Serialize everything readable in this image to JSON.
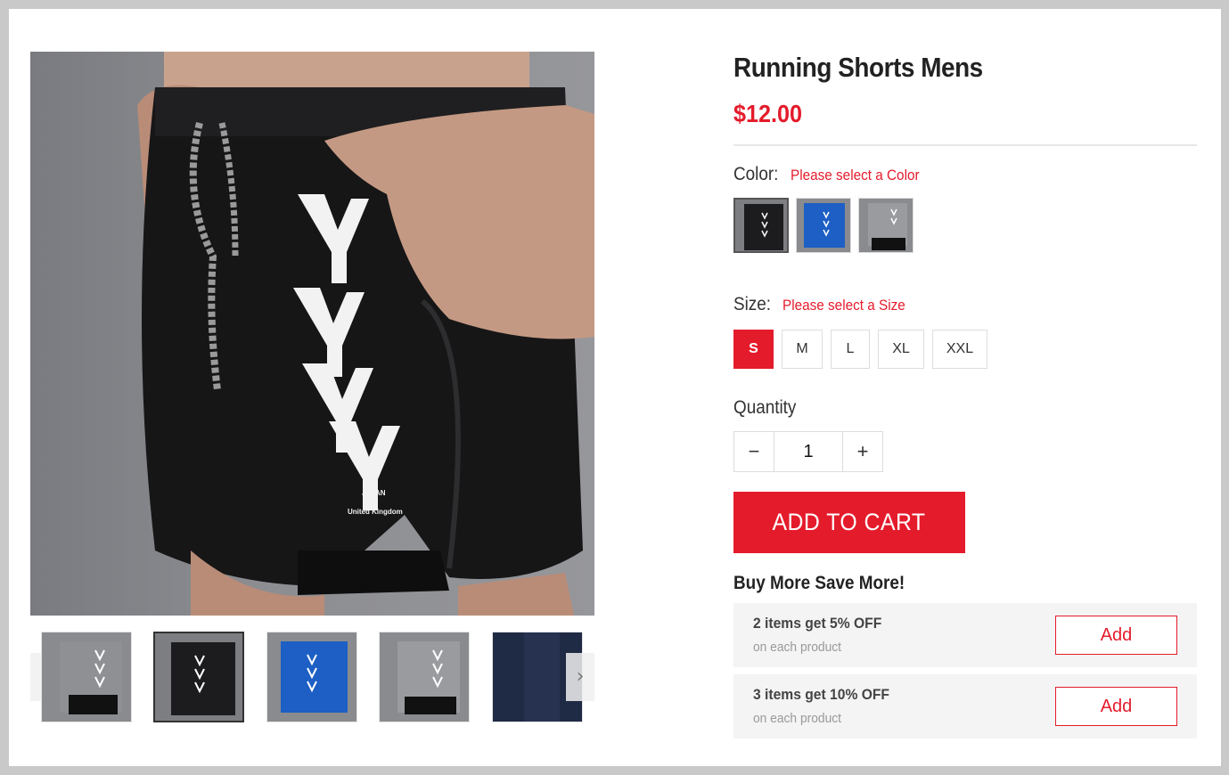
{
  "product": {
    "title": "Running Shorts Mens",
    "price": "$12.00"
  },
  "gallery": {
    "print_lines": [
      "JAPAN",
      "x",
      "United Kingdom"
    ],
    "thumbnails": [
      {
        "name": "gray",
        "color": "#8f9094"
      },
      {
        "name": "black",
        "color": "#1c1c1e"
      },
      {
        "name": "blue",
        "color": "#1d5fc4"
      },
      {
        "name": "gray-2",
        "color": "#8f9094"
      },
      {
        "name": "navy",
        "color": "#1f2a44"
      }
    ],
    "prev_icon": "‹",
    "next_icon": "›"
  },
  "color": {
    "label": "Color:",
    "hint": "Please select a Color",
    "options": [
      {
        "name": "black",
        "hex": "#1c1c1e"
      },
      {
        "name": "blue",
        "hex": "#1d5fc4"
      },
      {
        "name": "gray",
        "hex": "#8f9094"
      }
    ]
  },
  "size": {
    "label": "Size:",
    "hint": "Please select a Size",
    "options": [
      "S",
      "M",
      "L",
      "XL",
      "XXL"
    ],
    "selected": "S"
  },
  "quantity": {
    "label": "Quantity",
    "value": "1",
    "minus": "−",
    "plus": "+"
  },
  "cart": {
    "add_label": "ADD TO CART"
  },
  "bundle": {
    "title": "Buy More Save More!",
    "tiers": [
      {
        "title": "2 items get 5% OFF",
        "sub": "on each product",
        "button": "Add"
      },
      {
        "title": "3 items get 10% OFF",
        "sub": "on each product",
        "button": "Add"
      }
    ]
  },
  "colors": {
    "accent": "#e41b2b",
    "background": "#c9c9c9"
  }
}
